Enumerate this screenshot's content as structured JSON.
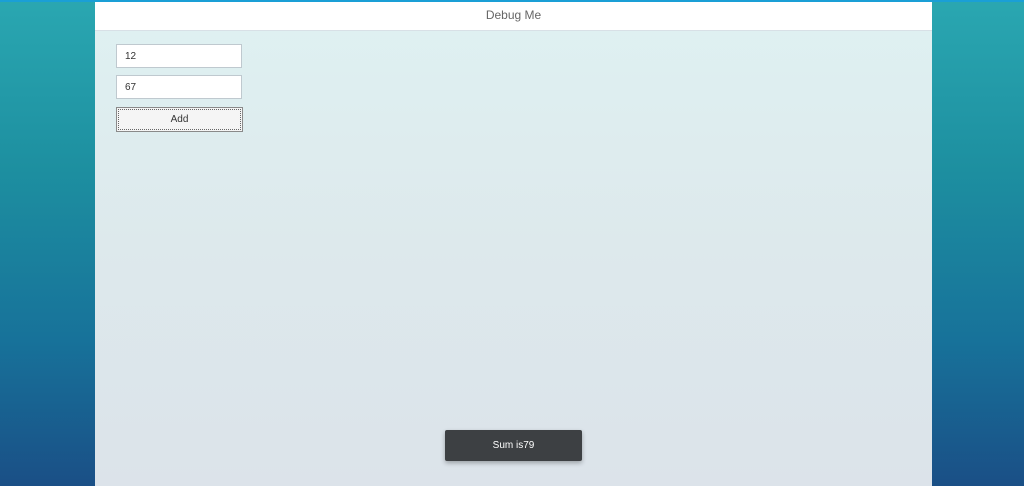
{
  "app": {
    "title": "Debug Me"
  },
  "form": {
    "first_value": "12",
    "second_value": "67",
    "add_label": "Add"
  },
  "toast": {
    "message": "Sum is79"
  },
  "colors": {
    "accent": "#1a9fd6",
    "toast_background": "#3d4043"
  }
}
